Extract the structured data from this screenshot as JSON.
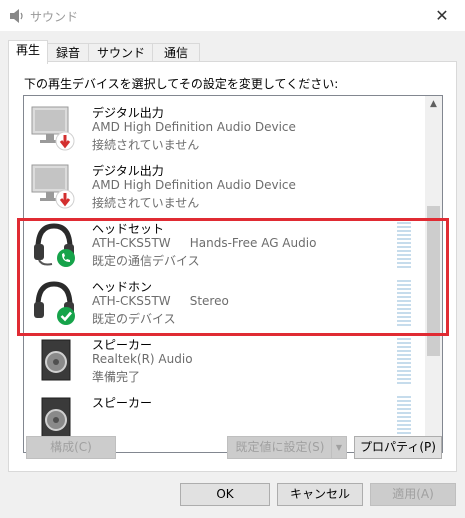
{
  "window": {
    "title": "サウンド",
    "close_glyph": "✕"
  },
  "tabs": [
    {
      "label": "再生"
    },
    {
      "label": "録音"
    },
    {
      "label": "サウンド"
    },
    {
      "label": "通信"
    }
  ],
  "instruction": "下の再生デバイスを選択してその設定を変更してください:",
  "devices": [
    {
      "name": "デジタル出力",
      "line2": "AMD High Definition Audio Device",
      "line3": "接続されていません",
      "icon": "monitor-icon"
    },
    {
      "name": "デジタル出力",
      "line2": "AMD High Definition Audio Device",
      "line3": "接続されていません",
      "icon": "monitor-icon"
    },
    {
      "name": "ヘッドセット",
      "line2": "ATH-CKS5TW     Hands-Free AG Audio",
      "line3": "既定の通信デバイス",
      "icon": "headset-icon"
    },
    {
      "name": "ヘッドホン",
      "line2": "ATH-CKS5TW     Stereo",
      "line3": "既定のデバイス",
      "icon": "headphones-icon"
    },
    {
      "name": "スピーカー",
      "line2": "Realtek(R) Audio",
      "line3": "準備完了",
      "icon": "speaker-icon"
    },
    {
      "name": "スピーカー",
      "line2": "",
      "line3": "",
      "icon": "speaker-icon"
    }
  ],
  "buttons": {
    "configure": "構成(C)",
    "set_default": "既定値に設定(S)",
    "properties": "プロパティ(P)",
    "ok": "OK",
    "cancel": "キャンセル",
    "apply": "適用(A)"
  },
  "colors": {
    "highlight": "#e02b33",
    "error_badge": "#d32f2f",
    "phone_badge": "#16a34a",
    "check_badge": "#16a34a"
  }
}
